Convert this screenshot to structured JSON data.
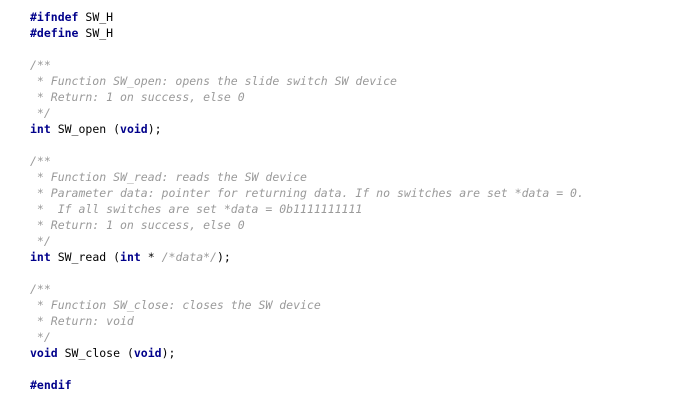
{
  "code": {
    "lines": [
      [
        {
          "t": "kw",
          "v": "#ifndef"
        },
        {
          "t": "plain",
          "v": " SW_H"
        }
      ],
      [
        {
          "t": "kw",
          "v": "#define"
        },
        {
          "t": "plain",
          "v": " SW_H"
        }
      ],
      [],
      [
        {
          "t": "cm",
          "v": "/**"
        }
      ],
      [
        {
          "t": "cm",
          "v": " * Function SW_open: opens the slide switch SW device"
        }
      ],
      [
        {
          "t": "cm",
          "v": " * Return: 1 on success, else 0"
        }
      ],
      [
        {
          "t": "cm",
          "v": " */"
        }
      ],
      [
        {
          "t": "kw",
          "v": "int"
        },
        {
          "t": "plain",
          "v": " SW_open ("
        },
        {
          "t": "kw",
          "v": "void"
        },
        {
          "t": "plain",
          "v": ");"
        }
      ],
      [],
      [
        {
          "t": "cm",
          "v": "/**"
        }
      ],
      [
        {
          "t": "cm",
          "v": " * Function SW_read: reads the SW device"
        }
      ],
      [
        {
          "t": "cm",
          "v": " * Parameter data: pointer for returning data. If no switches are set *data = 0."
        }
      ],
      [
        {
          "t": "cm",
          "v": " *  If all switches are set *data = 0b1111111111"
        }
      ],
      [
        {
          "t": "cm",
          "v": " * Return: 1 on success, else 0"
        }
      ],
      [
        {
          "t": "cm",
          "v": " */"
        }
      ],
      [
        {
          "t": "kw",
          "v": "int"
        },
        {
          "t": "plain",
          "v": " SW_read ("
        },
        {
          "t": "kw",
          "v": "int"
        },
        {
          "t": "plain",
          "v": " * "
        },
        {
          "t": "cm",
          "v": "/*data*/"
        },
        {
          "t": "plain",
          "v": ");"
        }
      ],
      [],
      [
        {
          "t": "cm",
          "v": "/**"
        }
      ],
      [
        {
          "t": "cm",
          "v": " * Function SW_close: closes the SW device"
        }
      ],
      [
        {
          "t": "cm",
          "v": " * Return: void"
        }
      ],
      [
        {
          "t": "cm",
          "v": " */"
        }
      ],
      [
        {
          "t": "kw",
          "v": "void"
        },
        {
          "t": "plain",
          "v": " SW_close ("
        },
        {
          "t": "kw",
          "v": "void"
        },
        {
          "t": "plain",
          "v": ");"
        }
      ],
      [],
      [
        {
          "t": "kw",
          "v": "#endif"
        }
      ]
    ]
  }
}
